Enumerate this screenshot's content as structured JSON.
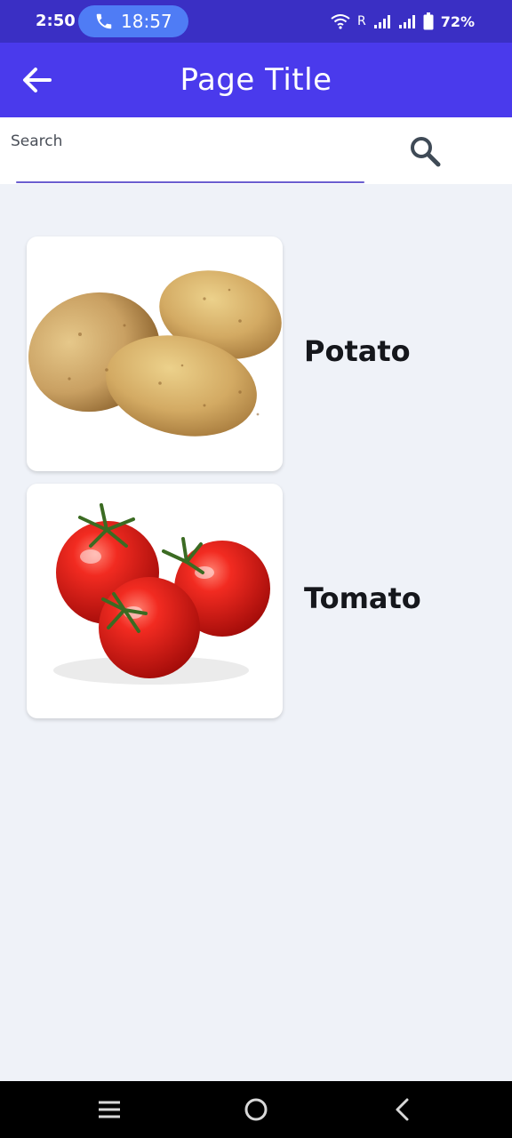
{
  "status_bar": {
    "time": "2:50",
    "call_timer": "18:57",
    "network_label": "R",
    "battery": "72%",
    "icons": [
      "phone-icon",
      "wifi-icon",
      "signal-icon",
      "signal-icon",
      "battery-icon"
    ]
  },
  "app_bar": {
    "title": "Page Title",
    "back_icon": "arrow-left-icon",
    "background": "#4a3aec"
  },
  "search": {
    "label": "Search",
    "value": "",
    "icon": "search-icon"
  },
  "items": [
    {
      "label": "Potato",
      "image": "potatoes"
    },
    {
      "label": "Tomato",
      "image": "tomatoes"
    }
  ],
  "nav_bar": {
    "icons": [
      "menu-icon",
      "home-circle-icon",
      "back-chevron-icon"
    ]
  }
}
